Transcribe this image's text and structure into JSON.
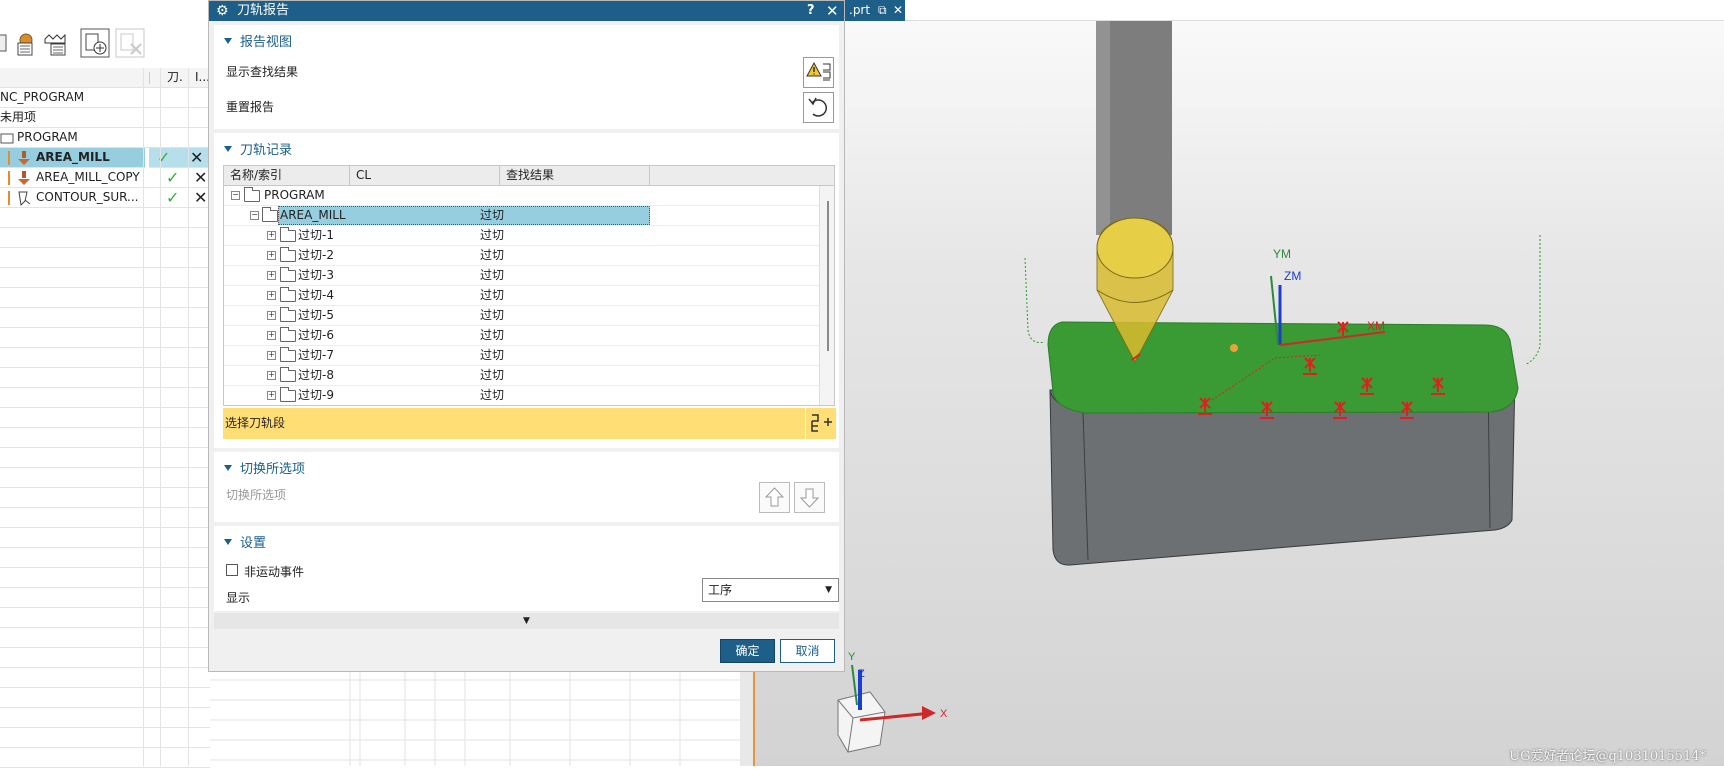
{
  "navigator": {
    "columns": [
      "刀.",
      "I..."
    ],
    "rows": [
      {
        "label": "NC_PROGRAM",
        "indent": 0
      },
      {
        "label": "未用项",
        "indent": 0
      },
      {
        "label": "PROGRAM",
        "indent": 1
      },
      {
        "label": "AREA_MILL",
        "indent": 2,
        "selected": true,
        "check": true,
        "cross": true
      },
      {
        "label": "AREA_MILL_COPY",
        "indent": 2,
        "check": true,
        "cross": true
      },
      {
        "label": "CONTOUR_SUR...",
        "indent": 2,
        "check": true,
        "cross": true
      }
    ]
  },
  "tab": {
    "label": ".prt"
  },
  "dialog": {
    "title": "刀轨报告",
    "help_icon": "?",
    "sections": {
      "report_view": {
        "header": "报告视图",
        "show_results": "显示查找结果",
        "reset_report": "重置报告"
      },
      "toolpath_records": {
        "header": "刀轨记录",
        "columns": [
          "名称/索引",
          "CL",
          "查找结果"
        ],
        "rows": [
          {
            "name": "PROGRAM",
            "cl": "",
            "result": "",
            "level": 0,
            "expander": "−"
          },
          {
            "name": "AREA_MILL",
            "cl": "",
            "result": "过切",
            "level": 1,
            "expander": "−",
            "selected": true
          },
          {
            "name": "过切-1",
            "cl": "",
            "result": "过切",
            "level": 2,
            "expander": "+"
          },
          {
            "name": "过切-2",
            "cl": "",
            "result": "过切",
            "level": 2,
            "expander": "+"
          },
          {
            "name": "过切-3",
            "cl": "",
            "result": "过切",
            "level": 2,
            "expander": "+"
          },
          {
            "name": "过切-4",
            "cl": "",
            "result": "过切",
            "level": 2,
            "expander": "+"
          },
          {
            "name": "过切-5",
            "cl": "",
            "result": "过切",
            "level": 2,
            "expander": "+"
          },
          {
            "name": "过切-6",
            "cl": "",
            "result": "过切",
            "level": 2,
            "expander": "+"
          },
          {
            "name": "过切-7",
            "cl": "",
            "result": "过切",
            "level": 2,
            "expander": "+"
          },
          {
            "name": "过切-8",
            "cl": "",
            "result": "过切",
            "level": 2,
            "expander": "+"
          },
          {
            "name": "过切-9",
            "cl": "",
            "result": "过切",
            "level": 2,
            "expander": "+"
          }
        ],
        "select_segment": "选择刀轨段"
      },
      "toggle": {
        "header": "切换所选项",
        "label": "切换所选项"
      },
      "settings": {
        "header": "设置",
        "non_motion_events": "非运动事件",
        "display_label": "显示",
        "display_value": "工序"
      }
    },
    "ok": "确定",
    "cancel": "取消"
  },
  "viewport": {
    "axis_labels": {
      "ym": "YM",
      "zm": "ZM",
      "xm": "XM",
      "x": "X",
      "y": "Y",
      "z": "Z"
    },
    "colors": {
      "part_top": "#3a9a33",
      "part_body": "#6c7073",
      "tool": "#d9bb2e",
      "shank": "#7d7d7d",
      "marker": "#e02020"
    }
  },
  "watermark": "UG爱好者论坛@q103101551​4*"
}
